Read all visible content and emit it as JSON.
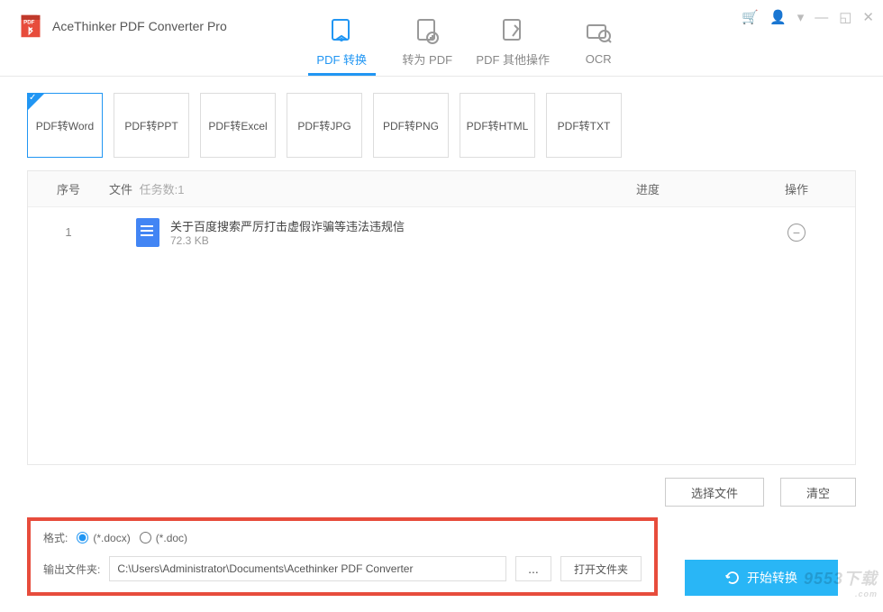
{
  "app": {
    "title": "AceThinker PDF Converter Pro"
  },
  "mainTabs": [
    {
      "label": "PDF 转换"
    },
    {
      "label": "转为 PDF"
    },
    {
      "label": "PDF 其他操作"
    },
    {
      "label": "OCR"
    }
  ],
  "formatTiles": [
    {
      "label": "PDF转Word"
    },
    {
      "label": "PDF转PPT"
    },
    {
      "label": "PDF转Excel"
    },
    {
      "label": "PDF转JPG"
    },
    {
      "label": "PDF转PNG"
    },
    {
      "label": "PDF转HTML"
    },
    {
      "label": "PDF转TXT"
    }
  ],
  "table": {
    "headers": {
      "index": "序号",
      "file": "文件",
      "taskCount": "任务数:1",
      "progress": "进度",
      "action": "操作"
    },
    "rows": [
      {
        "index": "1",
        "filename": "关于百度搜索严厉打击虚假诈骗等违法违规信",
        "filesize": "72.3 KB"
      }
    ]
  },
  "actions": {
    "selectFile": "选择文件",
    "clear": "清空"
  },
  "settings": {
    "formatLabel": "格式:",
    "opt1": "(*.docx)",
    "opt2": "(*.doc)",
    "outputLabel": "输出文件夹:",
    "outputPath": "C:\\Users\\Administrator\\Documents\\Acethinker PDF Converter",
    "browse": "...",
    "openFolder": "打开文件夹"
  },
  "startBtn": "开始转换",
  "watermark": {
    "main": "9553下载",
    "sub": ".com"
  }
}
